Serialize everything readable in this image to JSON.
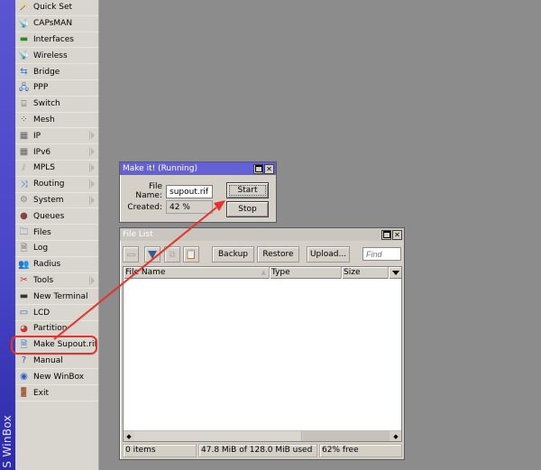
{
  "app": {
    "brand": "S WinBox"
  },
  "sidebar": {
    "items": [
      {
        "label": "Quick Set",
        "icon": "quick-set-icon",
        "glyph": "🪄",
        "submenu": false
      },
      {
        "label": "CAPsMAN",
        "icon": "capsman-icon",
        "glyph": "📡",
        "submenu": false
      },
      {
        "label": "Interfaces",
        "icon": "interfaces-icon",
        "glyph": "▬",
        "submenu": false
      },
      {
        "label": "Wireless",
        "icon": "wireless-icon",
        "glyph": "📡",
        "submenu": false
      },
      {
        "label": "Bridge",
        "icon": "bridge-icon",
        "glyph": "⇆",
        "submenu": false
      },
      {
        "label": "PPP",
        "icon": "ppp-icon",
        "glyph": "🖧",
        "submenu": false
      },
      {
        "label": "Switch",
        "icon": "switch-icon",
        "glyph": "⌸",
        "submenu": false
      },
      {
        "label": "Mesh",
        "icon": "mesh-icon",
        "glyph": "⁘",
        "submenu": false
      },
      {
        "label": "IP",
        "icon": "ip-icon",
        "glyph": "▦",
        "submenu": true
      },
      {
        "label": "IPv6",
        "icon": "ipv6-icon",
        "glyph": "▦",
        "submenu": true
      },
      {
        "label": "MPLS",
        "icon": "mpls-icon",
        "glyph": "⫽",
        "submenu": true
      },
      {
        "label": "Routing",
        "icon": "routing-icon",
        "glyph": "⤨",
        "submenu": true
      },
      {
        "label": "System",
        "icon": "system-icon",
        "glyph": "⚙",
        "submenu": true
      },
      {
        "label": "Queues",
        "icon": "queues-icon",
        "glyph": "●",
        "submenu": false
      },
      {
        "label": "Files",
        "icon": "files-icon",
        "glyph": "🗀",
        "submenu": false
      },
      {
        "label": "Log",
        "icon": "log-icon",
        "glyph": "🗎",
        "submenu": false
      },
      {
        "label": "Radius",
        "icon": "radius-icon",
        "glyph": "👥",
        "submenu": false
      },
      {
        "label": "Tools",
        "icon": "tools-icon",
        "glyph": "✂",
        "submenu": true
      },
      {
        "label": "New Terminal",
        "icon": "terminal-icon",
        "glyph": "▬",
        "submenu": false
      },
      {
        "label": "LCD",
        "icon": "lcd-icon",
        "glyph": "▭",
        "submenu": false
      },
      {
        "label": "Partition",
        "icon": "partition-icon",
        "glyph": "◕",
        "submenu": false
      },
      {
        "label": "Make Supout.rif",
        "icon": "make-supout-icon",
        "glyph": "🗎",
        "submenu": false
      },
      {
        "label": "Manual",
        "icon": "manual-icon",
        "glyph": "?",
        "submenu": false
      },
      {
        "label": "New WinBox",
        "icon": "new-winbox-icon",
        "glyph": "◉",
        "submenu": false
      },
      {
        "label": "Exit",
        "icon": "exit-icon",
        "glyph": "🚪",
        "submenu": false
      }
    ]
  },
  "make_it_window": {
    "title": "Make it! (Running)",
    "file_name_label": "File Name:",
    "file_name_value": "supout.rif",
    "created_label": "Created:",
    "created_value": "42 %",
    "start_label": "Start",
    "stop_label": "Stop"
  },
  "file_list_window": {
    "title": "File List",
    "toolbar": {
      "backup_label": "Backup",
      "restore_label": "Restore",
      "upload_label": "Upload...",
      "find_placeholder": "Find"
    },
    "columns": [
      {
        "label": "File Name"
      },
      {
        "label": "Type"
      },
      {
        "label": "Size"
      }
    ],
    "rows": [],
    "status": {
      "items": "0 items",
      "usage": "47.8 MiB of 128.0 MiB used",
      "free": "62% free"
    }
  },
  "colors": {
    "title_active": "#6461d4",
    "brand_bar": "#4a46c8",
    "annotation": "#e8312a"
  }
}
